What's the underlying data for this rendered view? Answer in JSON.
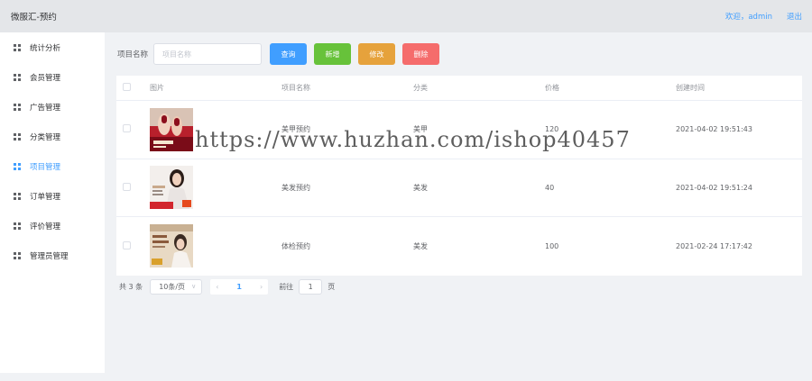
{
  "header": {
    "title": "微服汇-预约",
    "welcome": "欢迎，admin",
    "logout": "退出"
  },
  "sidebar": {
    "items": [
      {
        "label": "统计分析",
        "active": false
      },
      {
        "label": "会员管理",
        "active": false
      },
      {
        "label": "广告管理",
        "active": false
      },
      {
        "label": "分类管理",
        "active": false
      },
      {
        "label": "项目管理",
        "active": true
      },
      {
        "label": "订单管理",
        "active": false
      },
      {
        "label": "评价管理",
        "active": false
      },
      {
        "label": "管理员管理",
        "active": false
      }
    ]
  },
  "toolbar": {
    "search_label": "项目名称",
    "search_placeholder": "项目名称",
    "search_value": "",
    "query_label": "查询",
    "add_label": "新增",
    "edit_label": "修改",
    "delete_label": "删除"
  },
  "table": {
    "columns": [
      "图片",
      "项目名称",
      "分类",
      "价格",
      "创建时间"
    ],
    "rows": [
      {
        "name": "美甲预约",
        "category": "美甲",
        "price": "120",
        "created": "2021-04-02 19:51:43"
      },
      {
        "name": "美发预约",
        "category": "美发",
        "price": "40",
        "created": "2021-04-02 19:51:24"
      },
      {
        "name": "体检预约",
        "category": "美发",
        "price": "100",
        "created": "2021-02-24 17:17:42"
      }
    ]
  },
  "pagination": {
    "total_text": "共 3 条",
    "page_size": "10条/页",
    "current_page": "1",
    "goto_label": "前往",
    "goto_value": "1",
    "page_suffix": "页"
  },
  "watermark": "https://www.huzhan.com/ishop40457",
  "colors": {
    "primary": "#409eff",
    "success": "#67c23a",
    "warning": "#e6a23c",
    "danger": "#f56c6c"
  }
}
